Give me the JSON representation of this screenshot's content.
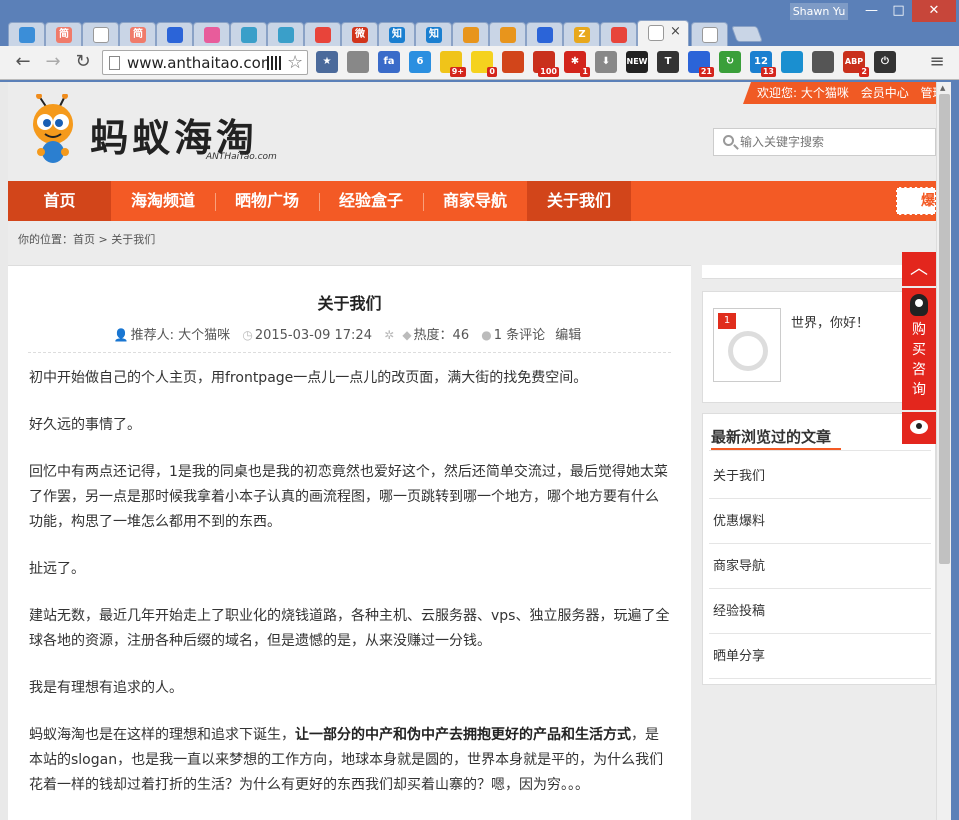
{
  "browser": {
    "user": "Shawn Yu",
    "tabs": [
      {
        "icon": "site-favicon",
        "label": "",
        "color": "#3b8ed8"
      },
      {
        "icon": "jian-icon",
        "label": "简",
        "color": "#f07b6a"
      },
      {
        "icon": "page-icon",
        "label": "",
        "color": "#ffffff"
      },
      {
        "icon": "jian-icon",
        "label": "简",
        "color": "#f07b6a"
      },
      {
        "icon": "paw-icon",
        "label": "",
        "color": "#2b64d8"
      },
      {
        "icon": "cloud-icon",
        "label": "",
        "color": "#e85c9b"
      },
      {
        "icon": "logo-icon",
        "label": "",
        "color": "#3a9fc9"
      },
      {
        "icon": "logo-icon",
        "label": "",
        "color": "#3a9fc9"
      },
      {
        "icon": "e-icon",
        "label": "",
        "color": "#e8443a"
      },
      {
        "icon": "weibo-icon",
        "label": "微",
        "color": "#d2351c"
      },
      {
        "icon": "zhihu-icon",
        "label": "知",
        "color": "#1a7fd0"
      },
      {
        "icon": "zhihu-icon",
        "label": "知",
        "color": "#1a7fd0"
      },
      {
        "icon": "orange-icon",
        "label": "",
        "color": "#e8951c"
      },
      {
        "icon": "orange-icon",
        "label": "",
        "color": "#e8951c"
      },
      {
        "icon": "paw-icon",
        "label": "",
        "color": "#2b64d8"
      },
      {
        "icon": "z-icon",
        "label": "Z",
        "color": "#e8a81c"
      },
      {
        "icon": "colorful-icon",
        "label": "",
        "color": "#e8443a"
      },
      {
        "icon": "page-icon",
        "label": "",
        "color": "#ffffff"
      },
      {
        "icon": "page-icon",
        "label": "",
        "color": "#ffffff"
      }
    ],
    "active_tab_close": "×",
    "url": "www.anthaitao.com",
    "extensions": [
      {
        "icon": "bookmark-star-icon",
        "label": "★",
        "color": "#4b6a9b",
        "badge": ""
      },
      {
        "icon": "globe-icon",
        "label": "",
        "color": "#888888",
        "badge": ""
      },
      {
        "icon": "fa-icon",
        "label": "fa",
        "color": "#3a6bc9",
        "badge": ""
      },
      {
        "icon": "six-icon",
        "label": "6",
        "color": "#2b8fe0",
        "badge": ""
      },
      {
        "icon": "notification-icon",
        "label": "",
        "color": "#f0c419",
        "badge": "9+"
      },
      {
        "icon": "note-icon",
        "label": "",
        "color": "#f5d21e",
        "badge": "0"
      },
      {
        "icon": "duck-icon",
        "label": "",
        "color": "#d2451a",
        "badge": ""
      },
      {
        "icon": "mail-icon",
        "label": "",
        "color": "#c9301c",
        "badge": "100"
      },
      {
        "icon": "asterisk-icon",
        "label": "✱",
        "color": "#d2251c",
        "badge": "1"
      },
      {
        "icon": "download-icon",
        "label": "⬇",
        "color": "#888888",
        "badge": ""
      },
      {
        "icon": "new-icon",
        "label": "NEW",
        "color": "#222222",
        "badge": ""
      },
      {
        "icon": "t-icon",
        "label": "T",
        "color": "#333333",
        "badge": ""
      },
      {
        "icon": "calendar-icon",
        "label": "",
        "color": "#2b64d8",
        "badge": "21"
      },
      {
        "icon": "refresh-icon",
        "label": "↻",
        "color": "#3a9f3a",
        "badge": ""
      },
      {
        "icon": "twelve-icon",
        "label": "12",
        "color": "#1a7fd0",
        "badge": "13"
      },
      {
        "icon": "edge-icon",
        "label": "",
        "color": "#1a8fd0",
        "badge": ""
      },
      {
        "icon": "evernote-icon",
        "label": "",
        "color": "#555555",
        "badge": ""
      },
      {
        "icon": "adblock-icon",
        "label": "ABP",
        "color": "#c9301c",
        "badge": "2"
      },
      {
        "icon": "power-icon",
        "label": "⏻",
        "color": "#333333",
        "badge": ""
      }
    ]
  },
  "site": {
    "welcome": "欢迎您: 大个猫咪",
    "member_center": "会员中心",
    "manage": "管理",
    "logo_text": "蚂蚁海淘",
    "logo_sub": "ANTHaiTao.com",
    "search_placeholder": "输入关键字搜索",
    "nav": [
      "首页",
      "海淘频道",
      "晒物广场",
      "经验盒子",
      "商家导航",
      "关于我们"
    ],
    "nav_right": "爆",
    "breadcrumb": "你的位置：首页 > 关于我们"
  },
  "article": {
    "title": "关于我们",
    "author": "推荐人: 大个猫咪",
    "date": "2015-03-09 17:24",
    "heat": "热度：46",
    "comments": "1 条评论",
    "edit": "编辑",
    "paragraphs": [
      "初中开始做自己的个人主页，用frontpage一点儿一点儿的改页面，满大街的找免费空间。",
      "好久远的事情了。",
      "回忆中有两点还记得，1是我的同桌也是我的初恋竟然也爱好这个，然后还简单交流过，最后觉得她太菜了作罢，另一点是那时候我拿着小本子认真的画流程图，哪一页跳转到哪一个地方，哪个地方要有什么功能，构思了一堆怎么都用不到的东西。",
      "扯远了。",
      "建站无数，最近几年开始走上了职业化的烧钱道路，各种主机、云服务器、vps、独立服务器，玩遍了全球各地的资源，注册各种后缀的域名，但是遗憾的是，从来没赚过一分钱。",
      "我是有理想有追求的人。"
    ],
    "last_pre": "蚂蚁海淘也是在这样的理想和追求下诞生，",
    "last_bold": "让一部分的中产和伪中产去拥抱更好的产品和生活方式",
    "last_post": "，是本站的slogan，也是我一直以来梦想的工作方向，地球本身就是圆的，世界本身就是平的，为什么我们花着一样的钱却过着打折的生活？为什么有更好的东西我们却买着山寨的？嗯，因为穷。。。"
  },
  "sidebar": {
    "badge_count": "1",
    "hello": "世界，你好！",
    "recent_title": "最新浏览过的文章",
    "recent": [
      "关于我们",
      "优惠爆料",
      "商家导航",
      "经验投稿",
      "晒单分享"
    ]
  },
  "floatbar": {
    "up": "︿",
    "buy": [
      "购",
      "买",
      "咨",
      "询"
    ]
  }
}
